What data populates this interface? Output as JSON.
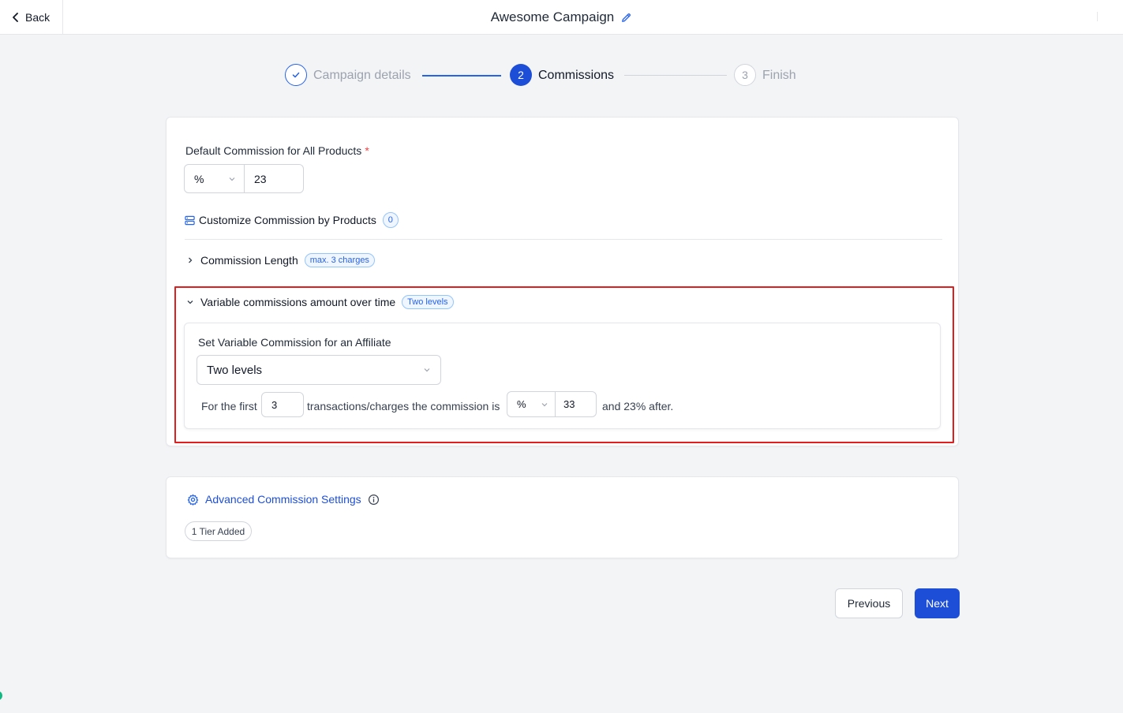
{
  "header": {
    "back_label": "Back",
    "title": "Awesome Campaign"
  },
  "stepper": {
    "steps": [
      {
        "number": "✓",
        "label": "Campaign details",
        "state": "complete"
      },
      {
        "number": "2",
        "label": "Commissions",
        "state": "active"
      },
      {
        "number": "3",
        "label": "Finish",
        "state": "upcoming"
      }
    ]
  },
  "default_commission": {
    "label": "Default Commission for All Products",
    "required_mark": "*",
    "type_value": "%",
    "amount_value": "23"
  },
  "customize": {
    "label": "Customize Commission by Products",
    "count": "0"
  },
  "commission_length": {
    "label": "Commission Length",
    "badge": "max. 3 charges"
  },
  "variable": {
    "label": "Variable commissions amount over time",
    "badge": "Two levels",
    "set_label": "Set Variable Commission for an Affiliate",
    "levels_value": "Two levels",
    "sentence_prefix": "For the first",
    "transactions_value": "3",
    "sentence_middle": "transactions/charges the commission is",
    "type_value": "%",
    "amount_value": "33",
    "sentence_suffix": "and 23% after."
  },
  "advanced": {
    "label": "Advanced Commission Settings",
    "tier_badge": "1 Tier Added"
  },
  "footer": {
    "previous_label": "Previous",
    "next_label": "Next"
  },
  "colors": {
    "accent": "#1d4ed8",
    "highlight_border": "#e11d1d",
    "badge_blue": "#2563eb"
  }
}
